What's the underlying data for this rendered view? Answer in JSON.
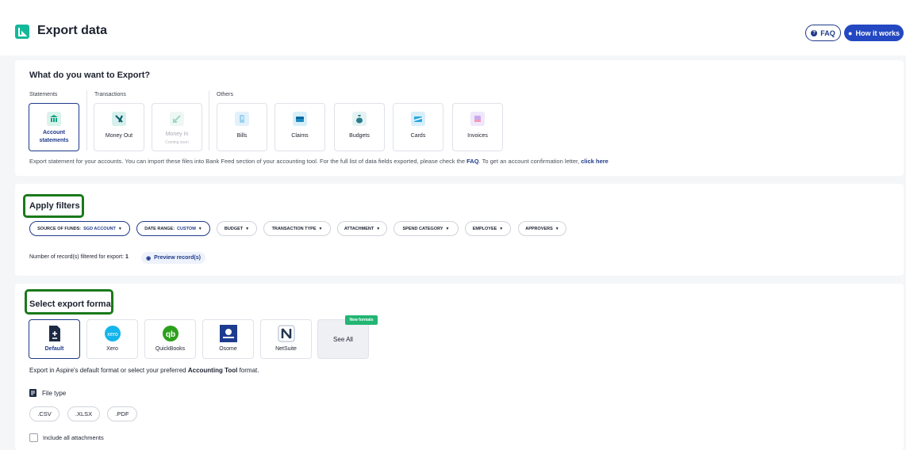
{
  "header": {
    "title": "Export data",
    "faq_label": "FAQ",
    "how_label": "How it works"
  },
  "export_what": {
    "title": "What do you want to Export?",
    "groups": {
      "statements": "Statements",
      "transactions": "Transactions",
      "others": "Others"
    },
    "tiles": [
      {
        "label": "Account statements",
        "sub": "",
        "state": "selected"
      },
      {
        "label": "Money Out",
        "sub": "",
        "state": "normal"
      },
      {
        "label": "Money In",
        "sub": "Coming soon",
        "state": "disabled"
      },
      {
        "label": "Bills",
        "sub": "",
        "state": "normal"
      },
      {
        "label": "Claims",
        "sub": "",
        "state": "normal"
      },
      {
        "label": "Budgets",
        "sub": "",
        "state": "normal"
      },
      {
        "label": "Cards",
        "sub": "",
        "state": "normal"
      },
      {
        "label": "Invoices",
        "sub": "",
        "state": "normal"
      }
    ],
    "hint": {
      "part1": "Export statement for your accounts. You can import these files into Bank Feed section of your accounting tool. For the full list of data fields exported, please check the ",
      "faq_link": "FAQ",
      "part2": ". To get an account confirmation letter, ",
      "click_link": "click here"
    }
  },
  "filters": {
    "title": "Apply filters",
    "chips": [
      {
        "label": "SOURCE OF FUNDS:",
        "value": "SGD ACCOUNT",
        "active": true
      },
      {
        "label": "DATE RANGE:",
        "value": "CUSTOM",
        "active": true
      },
      {
        "label": "BUDGET",
        "value": "",
        "active": false
      },
      {
        "label": "TRANSACTION TYPE",
        "value": "",
        "active": false
      },
      {
        "label": "ATTACHMENT",
        "value": "",
        "active": false
      },
      {
        "label": "SPEND CATEGORY",
        "value": "",
        "active": false
      },
      {
        "label": "EMPLOYEE",
        "value": "",
        "active": false
      },
      {
        "label": "APPROVERS",
        "value": "",
        "active": false
      }
    ],
    "records_label": "Number of record(s) filtered for export:",
    "records_count": "1",
    "preview_label": "Preview record(s)"
  },
  "format": {
    "title": "Select export format",
    "options": [
      {
        "label": "Default",
        "icon": "document-plus-icon",
        "selected": true
      },
      {
        "label": "Xero",
        "icon": "xero-logo-icon",
        "selected": false
      },
      {
        "label": "QuickBooks",
        "icon": "quickbooks-logo-icon",
        "selected": false
      },
      {
        "label": "Osome",
        "icon": "osome-logo-icon",
        "selected": false
      },
      {
        "label": "NetSuite",
        "icon": "netsuite-logo-icon",
        "selected": false
      },
      {
        "label": "See All",
        "icon": "",
        "selected": false
      }
    ],
    "new_badge": "New formats",
    "hint_part1": "Export in Aspire's default format or select your preferred ",
    "hint_bold": "Accounting Tool",
    "hint_part2": " format.",
    "file_type_label": "File type",
    "file_types": [
      ".CSV",
      ".XLSX",
      ".PDF"
    ],
    "attachments_label": "Include all attachments"
  },
  "colors": {
    "accent": "#1f3a8a",
    "brand_teal": "#13b89a",
    "annotation_green": "#1a7a1a",
    "badge_green": "#22b573"
  }
}
